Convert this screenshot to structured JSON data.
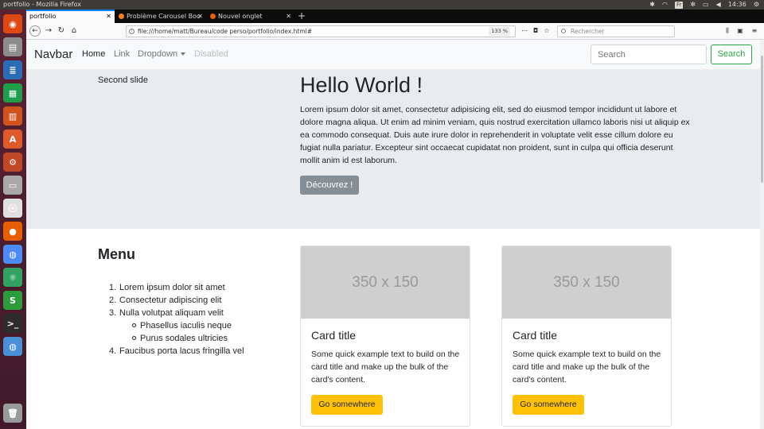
{
  "os": {
    "window_title": "portfolio - Mozilla Firefox",
    "keyboard_layout": "Fr",
    "clock": "14:36"
  },
  "launcher": {
    "items": [
      {
        "name": "ubuntu-dash-icon",
        "color": "#dd4814"
      },
      {
        "name": "files-icon",
        "color": "#8c8c8c"
      },
      {
        "name": "writer-icon",
        "color": "#2a6db5"
      },
      {
        "name": "calc-icon",
        "color": "#1f9d49"
      },
      {
        "name": "impress-icon",
        "color": "#d0521c"
      },
      {
        "name": "software-center-icon",
        "color": "#e0592a"
      },
      {
        "name": "settings-icon",
        "color": "#c04828"
      },
      {
        "name": "drive-icon",
        "color": "#a9a9a9"
      },
      {
        "name": "logout-icon",
        "color": "#e0e0e0"
      },
      {
        "name": "firefox-icon",
        "color": "#e66000"
      },
      {
        "name": "chrome-icon",
        "color": "#4c8bf5"
      },
      {
        "name": "atom-icon",
        "color": "#2fa35f"
      },
      {
        "name": "sublime-icon",
        "color": "#2d9c3c"
      },
      {
        "name": "terminal-icon",
        "color": "#2c2c2c"
      },
      {
        "name": "chromium-icon",
        "color": "#4a90d9"
      },
      {
        "name": "trash-icon",
        "color": "#9a9a9a"
      }
    ]
  },
  "browser": {
    "tabs": [
      {
        "label": "portfolio",
        "active": true
      },
      {
        "label": "Problème Carousel Boo",
        "active": false
      },
      {
        "label": "Nouvel onglet",
        "active": false
      }
    ],
    "url": "file:///home/matt/Bureau/code perso/portfolio/index.html#",
    "zoom": "133 %",
    "search_placeholder": "Rechercher"
  },
  "navbar": {
    "brand": "Navbar",
    "links": [
      {
        "label": "Home",
        "state": "active"
      },
      {
        "label": "Link",
        "state": "normal"
      },
      {
        "label": "Dropdown",
        "state": "dropdown"
      },
      {
        "label": "Disabled",
        "state": "disabled"
      }
    ],
    "search_placeholder": "Search",
    "search_button": "Search"
  },
  "hero": {
    "slide_label": "Second slide",
    "title": "Hello World !",
    "text": "Lorem ipsum dolor sit amet, consectetur adipisicing elit, sed do eiusmod tempor incididunt ut labore et dolore magna aliqua. Ut enim ad minim veniam, quis nostrud exercitation ullamco laboris nisi ut aliquip ex ea commodo consequat. Duis aute irure dolor in reprehenderit in voluptate velit esse cillum dolore eu fugiat nulla pariatur. Excepteur sint occaecat cupidatat non proident, sunt in culpa qui officia deserunt mollit anim id est laborum.",
    "button": "Découvrez !"
  },
  "menu": {
    "title": "Menu",
    "items": [
      {
        "num": "1.",
        "label": "Lorem ipsum dolor sit amet"
      },
      {
        "num": "2.",
        "label": "Consectetur adipiscing elit"
      },
      {
        "num": "3.",
        "label": "Nulla volutpat aliquam velit",
        "sub": [
          "Phasellus iaculis neque",
          "Purus sodales ultricies"
        ]
      },
      {
        "num": "4.",
        "label": "Faucibus porta lacus fringilla vel"
      }
    ]
  },
  "cards": [
    {
      "image_text": "350 x 150",
      "title": "Card title",
      "text": "Some quick example text to build on the card title and make up the bulk of the card's content.",
      "button": "Go somewhere"
    },
    {
      "image_text": "350 x 150",
      "title": "Card title",
      "text": "Some quick example text to build on the card title and make up the bulk of the card's content.",
      "button": "Go somewhere"
    }
  ]
}
